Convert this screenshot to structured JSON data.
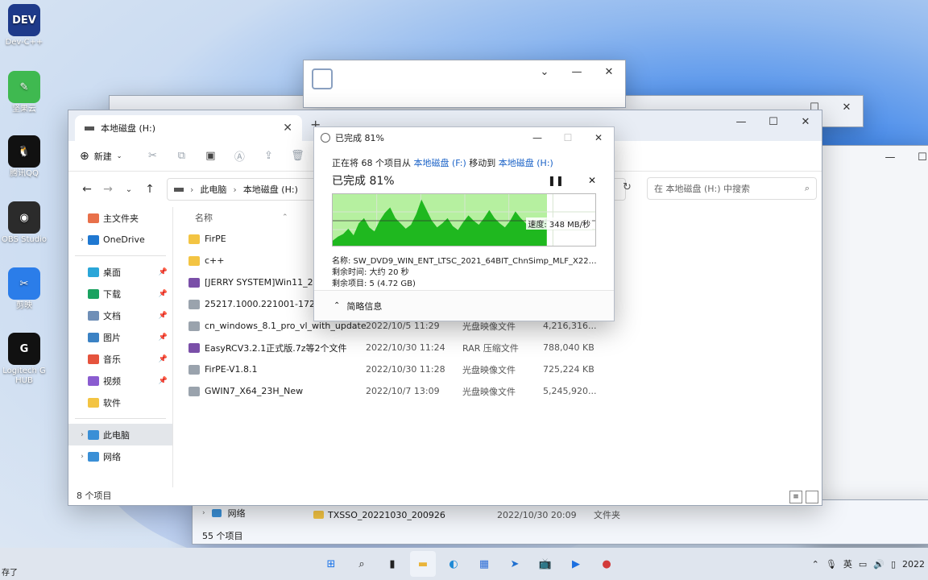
{
  "desktop": {
    "icons": [
      {
        "label": "Dev-C++",
        "icon": "devcpp-icon",
        "color": "#1e3a8a"
      },
      {
        "label": "坚果云",
        "icon": "nutstore-icon",
        "color": "#3fb950"
      },
      {
        "label": "腾讯QQ",
        "icon": "qq-icon",
        "color": "#111111"
      },
      {
        "label": "OBS Studio",
        "icon": "obs-icon",
        "color": "#2b2b2b"
      },
      {
        "label": "剪映",
        "icon": "jianying-icon",
        "color": "#2b7de9"
      },
      {
        "label": "Logitech G HUB",
        "icon": "logitech-icon",
        "color": "#111111"
      }
    ]
  },
  "explorer": {
    "tab_title": "本地磁盘 (H:)",
    "new_button": "新建",
    "breadcrumb": [
      "此电脑",
      "本地磁盘 (H:)"
    ],
    "search_placeholder": "在 本地磁盘 (H:) 中搜索",
    "column_name": "名称",
    "sidebar": [
      {
        "label": "主文件夹",
        "icon": "home-icon",
        "color": "#e8704a"
      },
      {
        "label": "OneDrive",
        "icon": "onedrive-icon",
        "color": "#1f78d1",
        "chevron": true
      },
      {
        "label": "桌面",
        "icon": "desktop-icon",
        "color": "#2aa6d8",
        "pin": true
      },
      {
        "label": "下载",
        "icon": "download-icon",
        "color": "#1aa260",
        "pin": true
      },
      {
        "label": "文档",
        "icon": "documents-icon",
        "color": "#6f8fb7",
        "pin": true
      },
      {
        "label": "图片",
        "icon": "pictures-icon",
        "color": "#3b82c4",
        "pin": true
      },
      {
        "label": "音乐",
        "icon": "music-icon",
        "color": "#e5533d",
        "pin": true
      },
      {
        "label": "视频",
        "icon": "videos-icon",
        "color": "#8a5cd0",
        "pin": true
      },
      {
        "label": "软件",
        "icon": "folder-icon",
        "color": "#f3c443"
      },
      {
        "label": "此电脑",
        "icon": "this-pc-icon",
        "color": "#3a8fd6",
        "chevron": true,
        "selected": true
      },
      {
        "label": "网络",
        "icon": "network-icon",
        "color": "#3a8fd6",
        "chevron": true
      }
    ],
    "files": [
      {
        "name": "FirPE",
        "date": "",
        "type": "",
        "size": "",
        "icon": "folder-icon",
        "color": "#f3c443"
      },
      {
        "name": "c++",
        "date": "",
        "type": "",
        "size": "",
        "icon": "folder-icon",
        "color": "#f3c443"
      },
      {
        "name": "[JERRY SYSTEM]Win11_22H2",
        "date": "",
        "type": "",
        "size": "",
        "icon": "rar-icon",
        "color": "#7a4fa8"
      },
      {
        "name": "25217.1000.221001-1723.RS_",
        "date": "",
        "type": "",
        "size": "",
        "icon": "disc-image-icon",
        "color": "#9aa3ad"
      },
      {
        "name": "cn_windows_8.1_pro_vl_with_update...",
        "date": "2022/10/5 11:29",
        "type": "光盘映像文件",
        "size": "4,216,316...",
        "icon": "disc-image-icon",
        "color": "#9aa3ad"
      },
      {
        "name": "EasyRCV3.2.1正式版.7z等2个文件",
        "date": "2022/10/30 11:24",
        "type": "RAR 压缩文件",
        "size": "788,040 KB",
        "icon": "rar-icon",
        "color": "#7a4fa8"
      },
      {
        "name": "FirPE-V1.8.1",
        "date": "2022/10/30 11:28",
        "type": "光盘映像文件",
        "size": "725,224 KB",
        "icon": "disc-image-icon",
        "color": "#9aa3ad"
      },
      {
        "name": "GWIN7_X64_23H_New",
        "date": "2022/10/7 13:09",
        "type": "光盘映像文件",
        "size": "5,245,920...",
        "icon": "disc-image-icon",
        "color": "#9aa3ad"
      }
    ],
    "status": "8 个项目"
  },
  "copy_dialog": {
    "title": "已完成 81%",
    "line1_prefix": "正在将 68 个项目从",
    "source": "本地磁盘 (F:)",
    "line1_mid": "移动到",
    "dest": "本地磁盘 (H:)",
    "percent_label": "已完成 81%",
    "progress_fraction": 0.81,
    "speed": "速度: 348 MB/秒",
    "name_line": "名称: SW_DVD9_WIN_ENT_LTSC_2021_64BIT_ChnSimp_MLF_X22-8...",
    "time_left": "剩余时间: 大约 20 秒",
    "items_left": "剩余项目: 5 (4.72 GB)",
    "details_toggle": "简略信息",
    "speed_series": [
      5,
      8,
      10,
      14,
      9,
      18,
      22,
      15,
      12,
      20,
      26,
      30,
      22,
      18,
      14,
      17,
      25,
      36,
      28,
      20,
      15,
      18,
      22,
      16,
      13,
      19,
      24,
      20,
      17,
      22,
      28,
      22,
      18,
      15,
      20,
      27,
      22,
      18,
      16,
      20,
      18,
      22
    ],
    "colors": {
      "done_fill": "#b6f0a0",
      "graph": "#1fb81f",
      "link": "#1a62c7"
    }
  },
  "back_window_bottom": {
    "nav_label": "网络",
    "file_name": "TXSSO_20221030_200926",
    "file_date": "2022/10/30 20:09",
    "file_type": "文件夹",
    "status": "55 个项目"
  },
  "taskbar": {
    "left_text": "存了",
    "apps": [
      "start-icon",
      "search-icon",
      "task-view-icon",
      "file-explorer-icon",
      "edge-icon",
      "store-icon",
      "feishu-icon",
      "bilibili-icon",
      "jianying-icon",
      "netease-music-icon"
    ],
    "ime": "英",
    "clock": "2022"
  }
}
